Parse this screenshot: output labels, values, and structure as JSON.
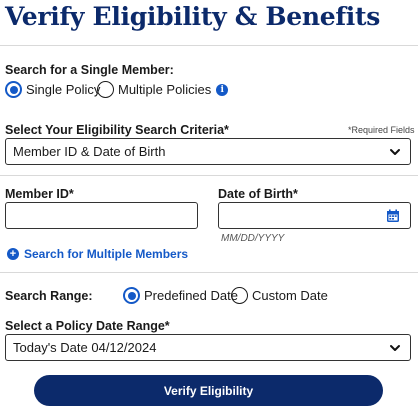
{
  "header": {
    "title": "Verify Eligibility & Benefits"
  },
  "member_search": {
    "label": "Search for a Single Member:",
    "options": [
      {
        "label": "Single Policy",
        "selected": true
      },
      {
        "label": "Multiple Policies",
        "selected": false
      }
    ],
    "info_icon": "info-icon"
  },
  "criteria": {
    "label": "Select Your Eligibility Search Criteria*",
    "required_note": "*Required Fields",
    "selected": "Member ID & Date of Birth"
  },
  "member_id": {
    "label": "Member ID*",
    "value": ""
  },
  "dob": {
    "label": "Date of Birth*",
    "value": "",
    "hint": "MM/DD/YYYY"
  },
  "multiple_link": {
    "label": "Search for Multiple Members"
  },
  "search_range": {
    "label": "Search Range:",
    "options": [
      {
        "label": "Predefined Date",
        "selected": true
      },
      {
        "label": "Custom Date",
        "selected": false
      }
    ]
  },
  "policy_range": {
    "label": "Select a Policy Date Range*",
    "selected": "Today's Date 04/12/2024"
  },
  "submit": {
    "label": "Verify Eligibility"
  },
  "colors": {
    "brand_navy": "#0c2a6b",
    "accent_blue": "#1459c7"
  }
}
